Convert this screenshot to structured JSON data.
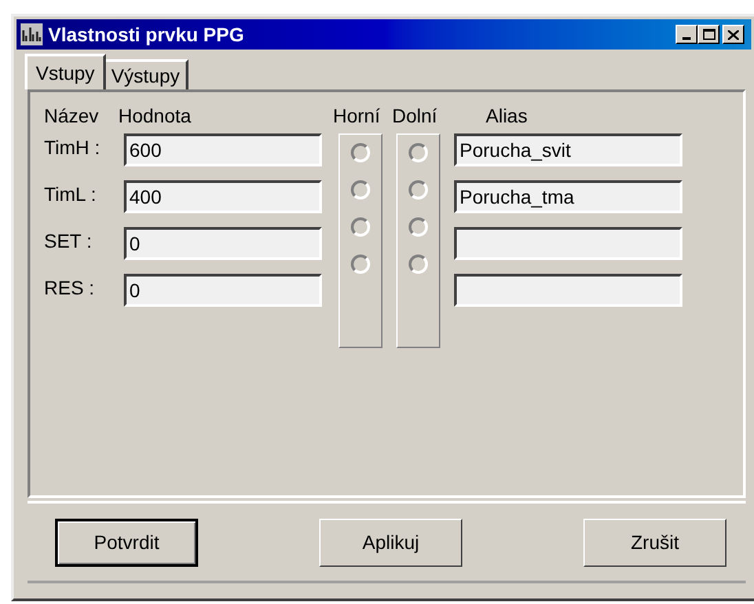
{
  "window": {
    "title": "Vlastnosti prvku PPG"
  },
  "tabs": [
    {
      "label": "Vstupy",
      "selected": true
    },
    {
      "label": "Výstupy",
      "selected": false
    }
  ],
  "headers": {
    "name": "Název",
    "value": "Hodnota",
    "upper": "Horní",
    "lower": "Dolní",
    "alias": "Alias"
  },
  "rows": [
    {
      "name": "TimH :",
      "value": "600",
      "upper_selected": false,
      "lower_selected": false,
      "alias": "Porucha_svit"
    },
    {
      "name": "TimL :",
      "value": "400",
      "upper_selected": false,
      "lower_selected": false,
      "alias": "Porucha_tma"
    },
    {
      "name": "SET :",
      "value": "0",
      "upper_selected": false,
      "lower_selected": false,
      "alias": ""
    },
    {
      "name": "RES :",
      "value": "0",
      "upper_selected": false,
      "lower_selected": false,
      "alias": ""
    }
  ],
  "buttons": [
    {
      "label": "Potvrdit",
      "default": true
    },
    {
      "label": "Aplikuj",
      "default": false
    },
    {
      "label": "Zrušit",
      "default": false
    }
  ]
}
